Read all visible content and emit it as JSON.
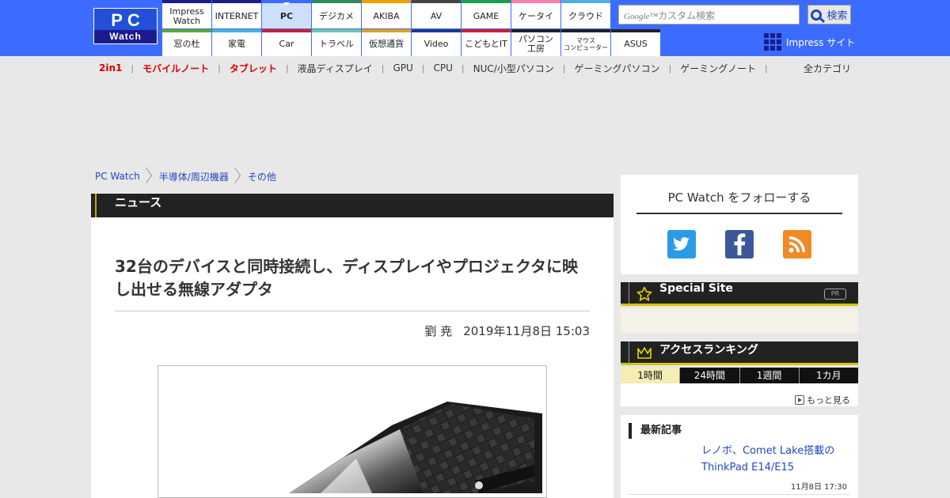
{
  "header": {
    "logo_top": "PC",
    "logo_bottom": "Watch",
    "nav_row1": [
      {
        "label": "Impress\nWatch",
        "color": "#1b1b8c"
      },
      {
        "label": "INTERNET",
        "color": "#1b1b8c"
      },
      {
        "label": "PC",
        "color": "#3c6cff"
      },
      {
        "label": "デジカメ",
        "color": "#2e8b57"
      },
      {
        "label": "AKIBA",
        "color": "#f0a000"
      },
      {
        "label": "AV",
        "color": "#444444"
      },
      {
        "label": "GAME",
        "color": "#1aa04a"
      },
      {
        "label": "ケータイ",
        "color": "#ff7eb0"
      },
      {
        "label": "クラウド",
        "color": "#4ab0e0"
      }
    ],
    "nav_row2": [
      {
        "label": "窓の杜",
        "color": "#5aaa30"
      },
      {
        "label": "家電",
        "color": "#4ab0e0"
      },
      {
        "label": "Car",
        "color": "#cc2030"
      },
      {
        "label": "トラベル",
        "color": "#6cc6b0"
      },
      {
        "label": "仮想通貨",
        "color": "#e0a020"
      },
      {
        "label": "Video",
        "color": "#1b3a8c"
      },
      {
        "label": "こどもとIT",
        "color": "#cc2030"
      },
      {
        "label": "パソコン\n工房",
        "color": "#222222"
      },
      {
        "label": "マウス\nコンピューター",
        "color": "#222222"
      },
      {
        "label": "ASUS",
        "color": "#222222"
      }
    ],
    "search_placeholder": "カスタム検索",
    "search_brand": "Google™",
    "search_button": "検索",
    "impress_link": "Impress サイト"
  },
  "categories": {
    "items": [
      {
        "label": "2in1",
        "highlight": true
      },
      {
        "label": "モバイルノート",
        "highlight": true
      },
      {
        "label": "タブレット",
        "highlight": true
      },
      {
        "label": "液晶ディスプレイ",
        "highlight": false
      },
      {
        "label": "GPU",
        "highlight": false
      },
      {
        "label": "CPU",
        "highlight": false
      },
      {
        "label": "NUC/小型パソコン",
        "highlight": false
      },
      {
        "label": "ゲーミングパソコン",
        "highlight": false
      },
      {
        "label": "ゲーミングノート",
        "highlight": false
      }
    ],
    "separator": "|",
    "all": "全カテゴリ"
  },
  "breadcrumb": [
    "PC Watch",
    "半導体/周辺機器",
    "その他"
  ],
  "article": {
    "section": "ニュース",
    "title": "32台のデバイスと同時接続し、ディスプレイやプロジェクタに映し出せる無線アダプタ",
    "author": "劉 尭",
    "date": "2019年11月8日 15:03"
  },
  "sidebar": {
    "follow_title": "PC Watch をフォローする",
    "sns": {
      "twitter": "twitter-icon",
      "facebook": "facebook-icon",
      "rss": "rss-icon"
    },
    "special_title": "Special Site",
    "special_badge": "PR",
    "ranking_title": "アクセスランキング",
    "ranking_tabs": [
      "1時間",
      "24時間",
      "1週間",
      "1カ月"
    ],
    "ranking_active": 0,
    "more_label": "もっと見る",
    "latest_title": "最新記事",
    "latest_items": [
      {
        "title": "レノボ、Comet Lake搭載のThinkPad E14/E15",
        "time": "11月8日 17:30"
      }
    ]
  }
}
